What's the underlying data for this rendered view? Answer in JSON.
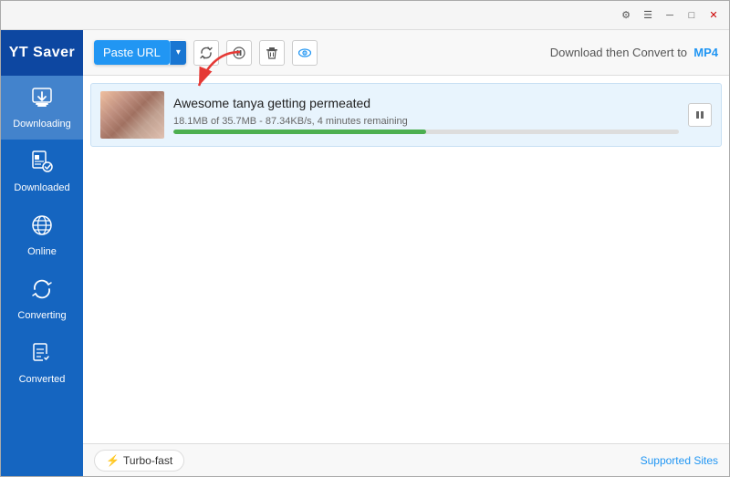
{
  "app": {
    "name": "YT Saver"
  },
  "titlebar": {
    "settings_icon": "⚙",
    "menu_icon": "☰",
    "minimize_icon": "─",
    "maximize_icon": "□",
    "close_icon": "✕"
  },
  "sidebar": {
    "items": [
      {
        "id": "downloading",
        "label": "Downloading",
        "icon": "⬇",
        "active": true
      },
      {
        "id": "downloaded",
        "label": "Downloaded",
        "icon": "🎬",
        "active": false
      },
      {
        "id": "online",
        "label": "Online",
        "icon": "🌐",
        "active": false
      },
      {
        "id": "converting",
        "label": "Converting",
        "icon": "🔄",
        "active": false
      },
      {
        "id": "converted",
        "label": "Converted",
        "icon": "📋",
        "active": false
      }
    ]
  },
  "toolbar": {
    "paste_url_label": "Paste URL",
    "download_then_convert": "Download then Convert to",
    "format": "MP4"
  },
  "download": {
    "title": "Awesome tanya getting permeated",
    "stats": "18.1MB of 35.7MB - 87.34KB/s, 4 minutes remaining",
    "progress_percent": 50
  },
  "footer": {
    "turbo_label": "Turbo-fast",
    "supported_sites": "Supported Sites"
  }
}
